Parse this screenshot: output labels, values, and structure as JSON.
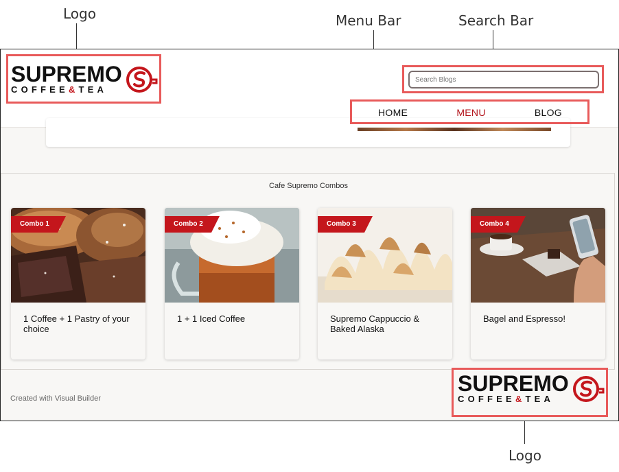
{
  "annotations": {
    "logo_top": "Logo",
    "menu_bar": "Menu Bar",
    "search_bar": "Search Bar",
    "logo_bottom": "Logo"
  },
  "brand": {
    "name": "SUPREMO",
    "sub_left": "COFFEE",
    "sub_amp": "&",
    "sub_right": "TEA",
    "accent_color": "#c4161c"
  },
  "search": {
    "placeholder": "Search Blogs"
  },
  "nav": {
    "items": [
      {
        "label": "HOME",
        "active": false
      },
      {
        "label": "MENU",
        "active": true
      },
      {
        "label": "BLOG",
        "active": false
      }
    ]
  },
  "combos": {
    "title": "Cafe Supremo Combos",
    "cards": [
      {
        "badge": "Combo 1",
        "text": "1 Coffee + 1 Pastry of your choice",
        "image": "pastries-photo"
      },
      {
        "badge": "Combo 2",
        "text": "1 + 1 Iced Coffee",
        "image": "iced-coffee-photo"
      },
      {
        "badge": "Combo 3",
        "text": "Supremo Cappuccio & Baked Alaska",
        "image": "meringue-photo"
      },
      {
        "badge": "Combo 4",
        "text": "Bagel and Espresso!",
        "image": "espresso-phone-photo"
      }
    ]
  },
  "footer": {
    "credit": "Created with Visual Builder"
  }
}
